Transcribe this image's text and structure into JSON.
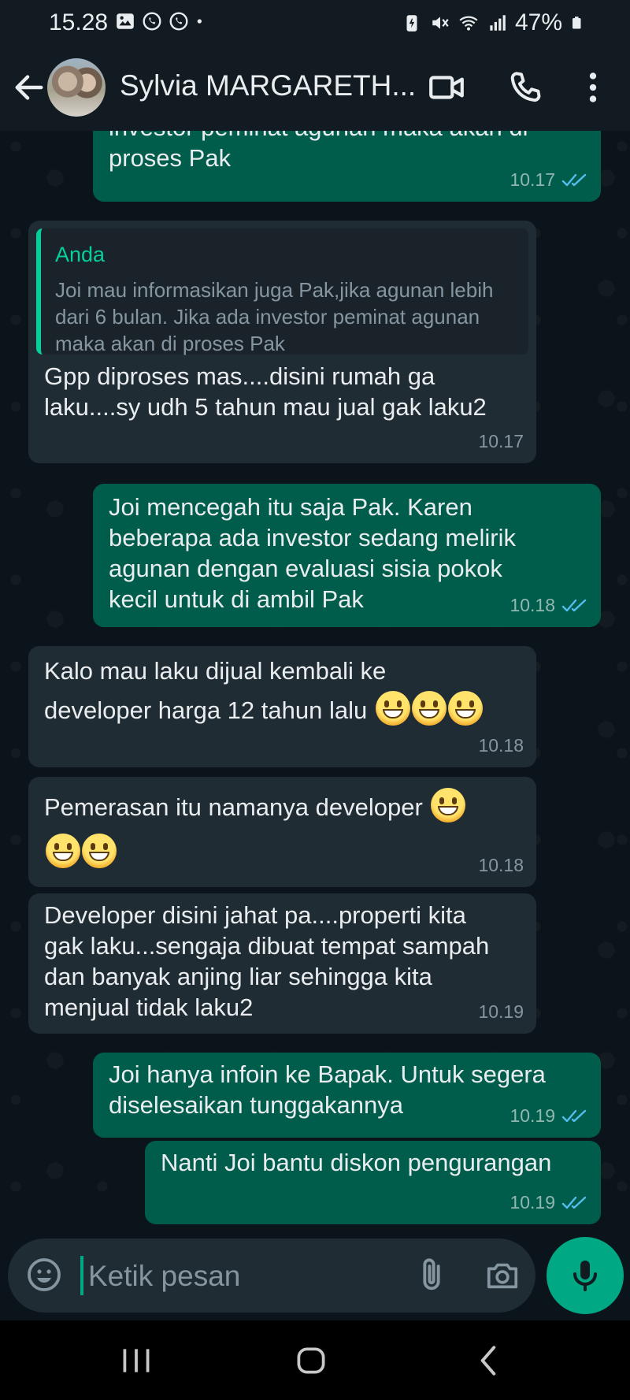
{
  "status_bar": {
    "time": "15.28",
    "battery": "47%",
    "left_icons": [
      "gallery-icon",
      "whatsapp-icon",
      "whatsapp-icon",
      "dot-icon"
    ],
    "right_icons": [
      "battery-saver-icon",
      "mute-icon",
      "wifi-icon",
      "signal-icon",
      "battery-icon"
    ]
  },
  "header": {
    "contact_name": "Sylvia MARGARETH...",
    "icons": [
      "back-arrow-icon",
      "avatar",
      "video-call-icon",
      "phone-call-icon",
      "more-options-icon"
    ]
  },
  "messages": [
    {
      "id": "m1",
      "direction": "outgoing",
      "text": "investor peminat agunan maka akan di\nproses Pak",
      "time": "10.17",
      "status": "read"
    },
    {
      "id": "m2",
      "direction": "incoming",
      "quote": {
        "author": "Anda",
        "text": "Joi mau informasikan juga Pak,jika agunan lebih dari 6 bulan. Jika ada investor peminat agunan maka akan di proses Pak"
      },
      "text": "Gpp diproses mas....disini rumah ga\nlaku....sy udh 5 tahun mau jual gak laku2",
      "time": "10.17"
    },
    {
      "id": "m3",
      "direction": "outgoing",
      "text": "Joi mencegah itu saja Pak. Karen\nbeberapa ada investor sedang melirik\nagunan dengan evaluasi sisia pokok\nkecil untuk di ambil Pak",
      "time": "10.18",
      "status": "read"
    },
    {
      "id": "m4",
      "direction": "incoming",
      "text_line1": "Kalo mau laku dijual kembali ke",
      "text_line2": "developer harga 12 tahun lalu",
      "emoji": "😀😀😀",
      "time": "10.18"
    },
    {
      "id": "m5",
      "direction": "incoming",
      "text_line1": "Pemerasan itu namanya developer",
      "emoji": "😀😀😀",
      "time": "10.18"
    },
    {
      "id": "m6",
      "direction": "incoming",
      "text": "Developer disini jahat pa....properti kita\ngak laku...sengaja dibuat tempat sampah\ndan banyak anjing liar sehingga kita\nmenjual tidak laku2",
      "time": "10.19"
    },
    {
      "id": "m7",
      "direction": "outgoing",
      "text": "Joi hanya infoin ke Bapak. Untuk segera\ndiselesaikan tunggakannya",
      "time": "10.19",
      "status": "read"
    },
    {
      "id": "m8",
      "direction": "outgoing",
      "text": "Nanti Joi bantu diskon pengurangan",
      "time": "10.19",
      "status": "read"
    }
  ],
  "composer": {
    "placeholder": "Ketik pesan",
    "icons": [
      "emoji-icon",
      "attach-icon",
      "camera-icon",
      "mic-icon"
    ]
  },
  "nav_bar": {
    "icons": [
      "recent-apps-icon",
      "home-icon",
      "back-icon"
    ]
  },
  "colors": {
    "chat_background": "#0b141a",
    "header_background": "#111b21",
    "outgoing_bubble": "#005c4b",
    "incoming_bubble": "#202c33",
    "accent": "#00a884",
    "read_ticks": "#53bdeb"
  }
}
